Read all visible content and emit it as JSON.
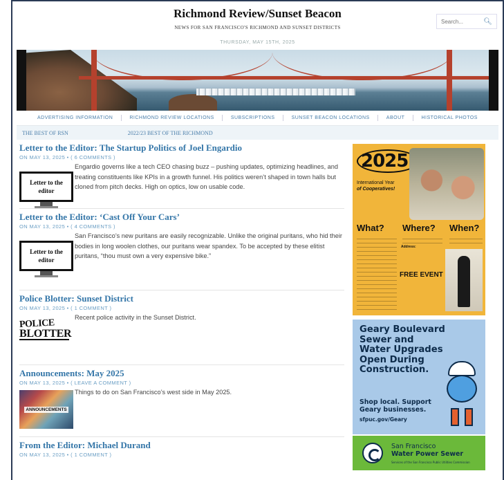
{
  "header": {
    "title": "Richmond Review/Sunset Beacon",
    "tagline": "NEWS FOR SAN FRANCISCO'S RICHMOND AND SUNSET DISTRICTS",
    "date": "THURSDAY, MAY 15TH, 2025"
  },
  "search": {
    "placeholder": "Search..."
  },
  "nav": {
    "items": [
      "ADVERTISING INFORMATION",
      "RICHMOND REVIEW LOCATIONS",
      "SUBSCRIPTIONS",
      "SUNSET BEACON LOCATIONS",
      "ABOUT",
      "HISTORICAL PHOTOS"
    ]
  },
  "subnav": {
    "items": [
      "THE BEST OF RSN",
      "2022/23 BEST OF THE RICHMOND"
    ]
  },
  "posts": [
    {
      "title": "Letter to the Editor: The Startup Politics of Joel Engardio",
      "date": "MAY 13, 2025",
      "comments": "6 COMMENTS",
      "excerpt": "Engardio governs like a tech CEO chasing buzz – pushing updates, optimizing headlines, and treating constituents like KPIs in a growth funnel. His politics weren’t shaped in town halls but cloned from pitch decks. High on optics, low on usable code.",
      "thumb_label": "Letter to the editor"
    },
    {
      "title": "Letter to the Editor: ‘Cast Off Your Cars’",
      "date": "MAY 13, 2025",
      "comments": "4 COMMENTS",
      "excerpt": "San Francisco’s new puritans are easily recognizable. Unlike the original puritans, who hid their bodies in long woolen clothes, our puritans wear spandex. To be accepted by these elitist puritans, “thou must own a very expensive bike.”",
      "thumb_label": "Letter to the editor"
    },
    {
      "title": "Police Blotter: Sunset District",
      "date": "MAY 13, 2025",
      "comments": "1 COMMENT",
      "excerpt": "Recent police activity in the Sunset District.",
      "thumb_line1": "POLICE",
      "thumb_line2": "BLOTTER"
    },
    {
      "title": "Announcements: May 2025",
      "date": "MAY 13, 2025",
      "comments": "LEAVE A COMMENT",
      "excerpt": "Things to do on San Francisco’s west side in May 2025.",
      "thumb_label": "ANNOUNCEMENTS"
    },
    {
      "title": "From the Editor: Michael Durand",
      "date": "MAY 13, 2025",
      "comments": "1 COMMENT"
    }
  ],
  "meta_prefix": "ON",
  "ad1": {
    "year": "2025:",
    "intl_line1": "International Year",
    "intl_line2": "of Cooperatives!",
    "what": "What?",
    "where": "Where?",
    "when": "When?",
    "address_label": "Address:",
    "free_event": "FREE EVENT"
  },
  "ad2": {
    "headline": "Geary Boulevard Sewer and Water Upgrades Open During Construction.",
    "sub": "Shop local. Support Geary businesses.",
    "url": "sfpuc.gov/Geary",
    "org_line1": "San Francisco",
    "org_line2": "Water Power Sewer",
    "org_tiny": "Services of the San Francisco Public Utilities Commission"
  },
  "colors": {
    "link": "#3476a8",
    "meta": "#6a9ec4",
    "border": "#2a3a55"
  }
}
